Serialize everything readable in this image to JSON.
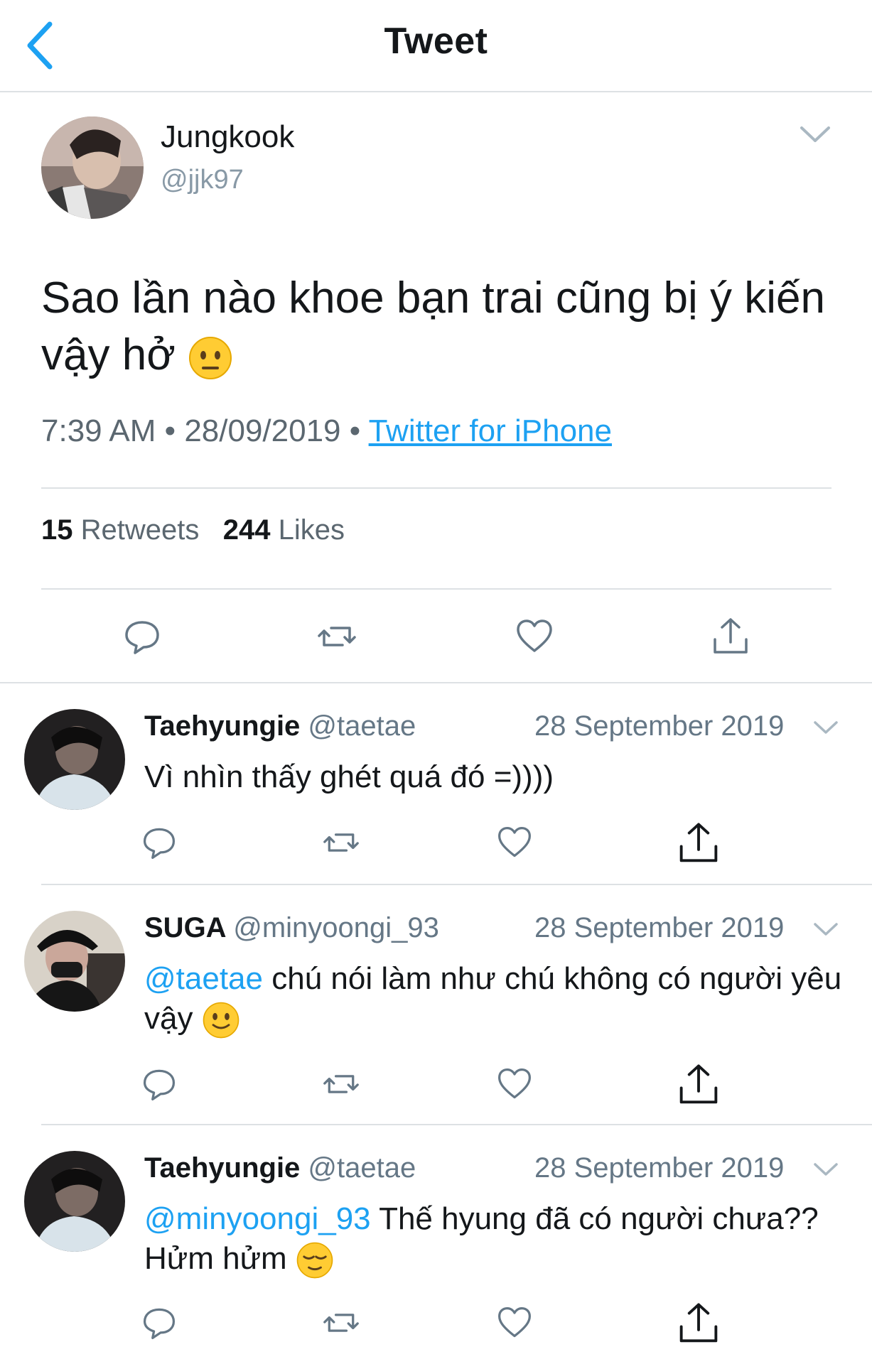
{
  "header": {
    "title": "Tweet",
    "back_icon": "chevron-left-icon"
  },
  "tweet": {
    "author_name": "Jungkook",
    "author_handle": "@jjk97",
    "text": "Sao lần nào khoe bạn trai cũng bị ý kiến vậy hở",
    "emoji": "neutral-face-emoji",
    "time": "7:39 AM",
    "date": "28/09/2019",
    "source": "Twitter for iPhone",
    "retweets_count": "15",
    "retweets_label": "Retweets",
    "likes_count": "244",
    "likes_label": "Likes"
  },
  "replies": [
    {
      "name": "Taehyungie",
      "handle": "@taetae",
      "date": "28 September 2019",
      "mention": "",
      "text": "Vì nhìn thấy ghét quá đó =))))",
      "emoji": ""
    },
    {
      "name": "SUGA",
      "handle": "@minyoongi_93",
      "date": "28 September 2019",
      "mention": "@taetae",
      "text": " chú nói làm như chú không có người yêu vậy",
      "emoji": "slightly-smiling-face-emoji"
    },
    {
      "name": "Taehyungie",
      "handle": "@taetae",
      "date": "28 September 2019",
      "mention": "@minyoongi_93",
      "text": " Thế hyung đã có người chưa?? Hửm hửm",
      "emoji": "relieved-face-emoji"
    }
  ],
  "colors": {
    "link": "#1da1f2",
    "secondary_text": "#657786",
    "divider": "#dde1e4"
  }
}
